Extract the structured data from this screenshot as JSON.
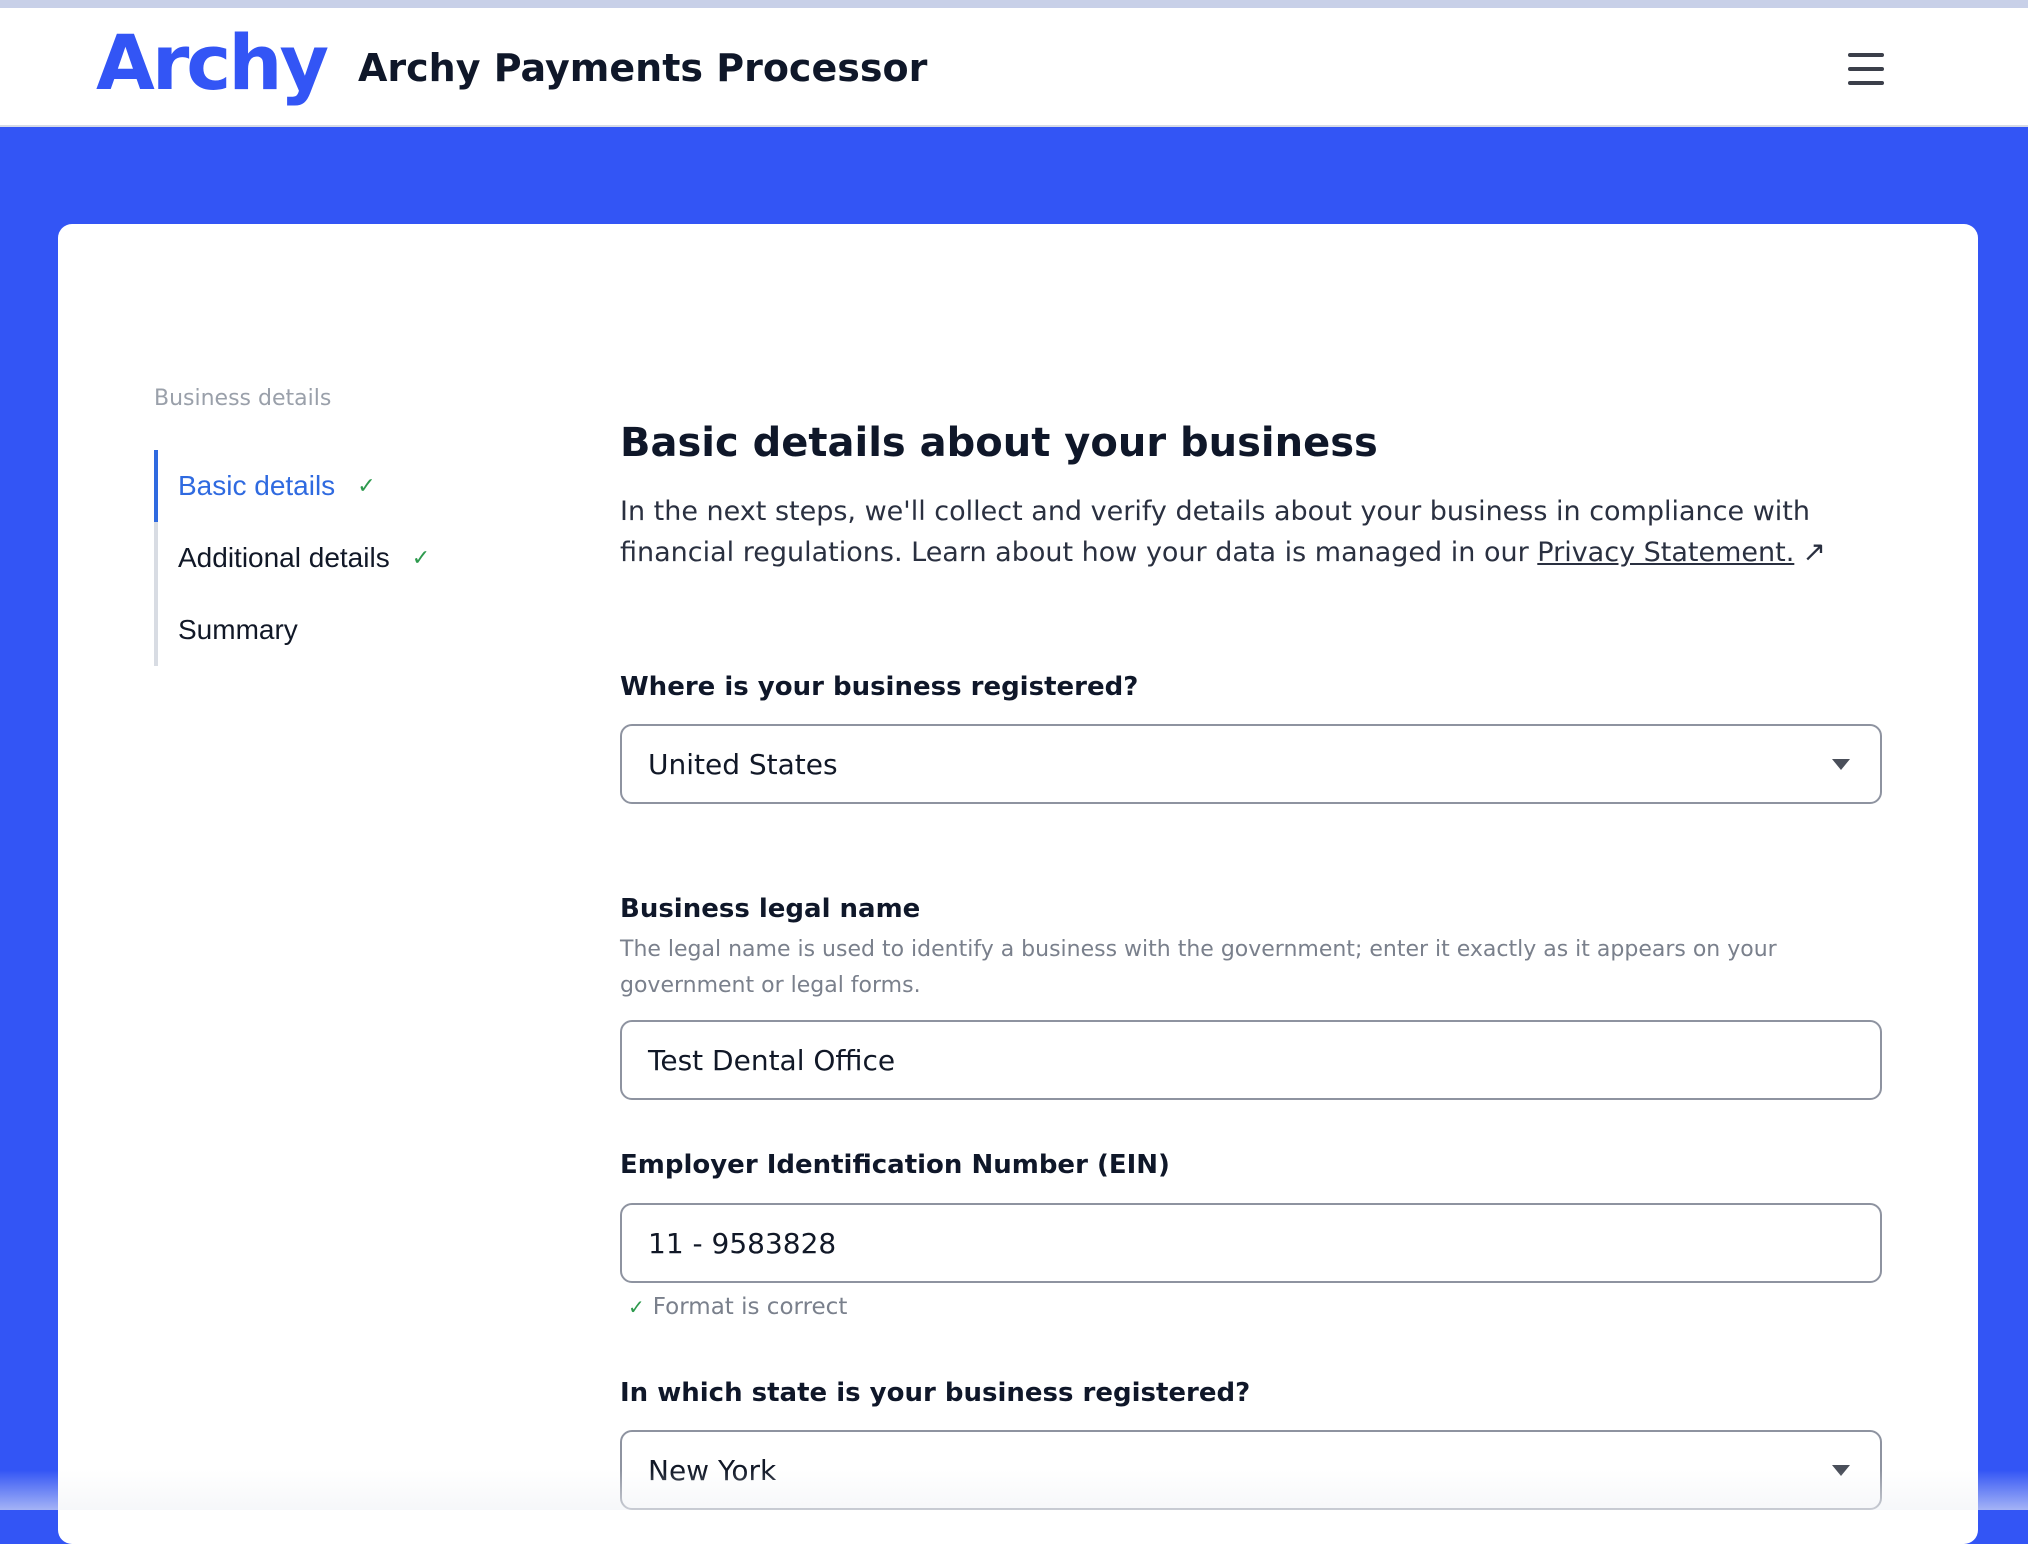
{
  "header": {
    "logo_text": "Archy",
    "app_title": "Archy Payments Processor",
    "menu_icon": "hamburger-menu-icon"
  },
  "sidebar": {
    "heading": "Business details",
    "items": [
      {
        "label": "Basic details",
        "completed": true,
        "active": true
      },
      {
        "label": "Additional details",
        "completed": true,
        "active": false
      },
      {
        "label": "Summary",
        "completed": false,
        "active": false
      }
    ]
  },
  "main": {
    "title": "Basic details about your business",
    "intro_text": "In the next steps, we'll collect and verify details about your business in compliance with financial regulations. Learn about how your data is managed in our",
    "privacy_link": "Privacy Statement.",
    "fields": {
      "country": {
        "label": "Where is your business registered?",
        "value": "United States"
      },
      "legal_name": {
        "label": "Business legal name",
        "help": "The legal name is used to identify a business with the government; enter it exactly as it appears on your government or legal forms.",
        "value": "Test Dental Office"
      },
      "ein": {
        "label": "Employer Identification Number (EIN)",
        "value": "11 - 9583828",
        "validation": "Format is correct"
      },
      "state": {
        "label": "In which state is your business registered?",
        "value": "New York"
      }
    }
  },
  "colors": {
    "brand_blue": "#3355f5",
    "active_nav": "#2f6ae0",
    "success_green": "#2e9a4e"
  }
}
